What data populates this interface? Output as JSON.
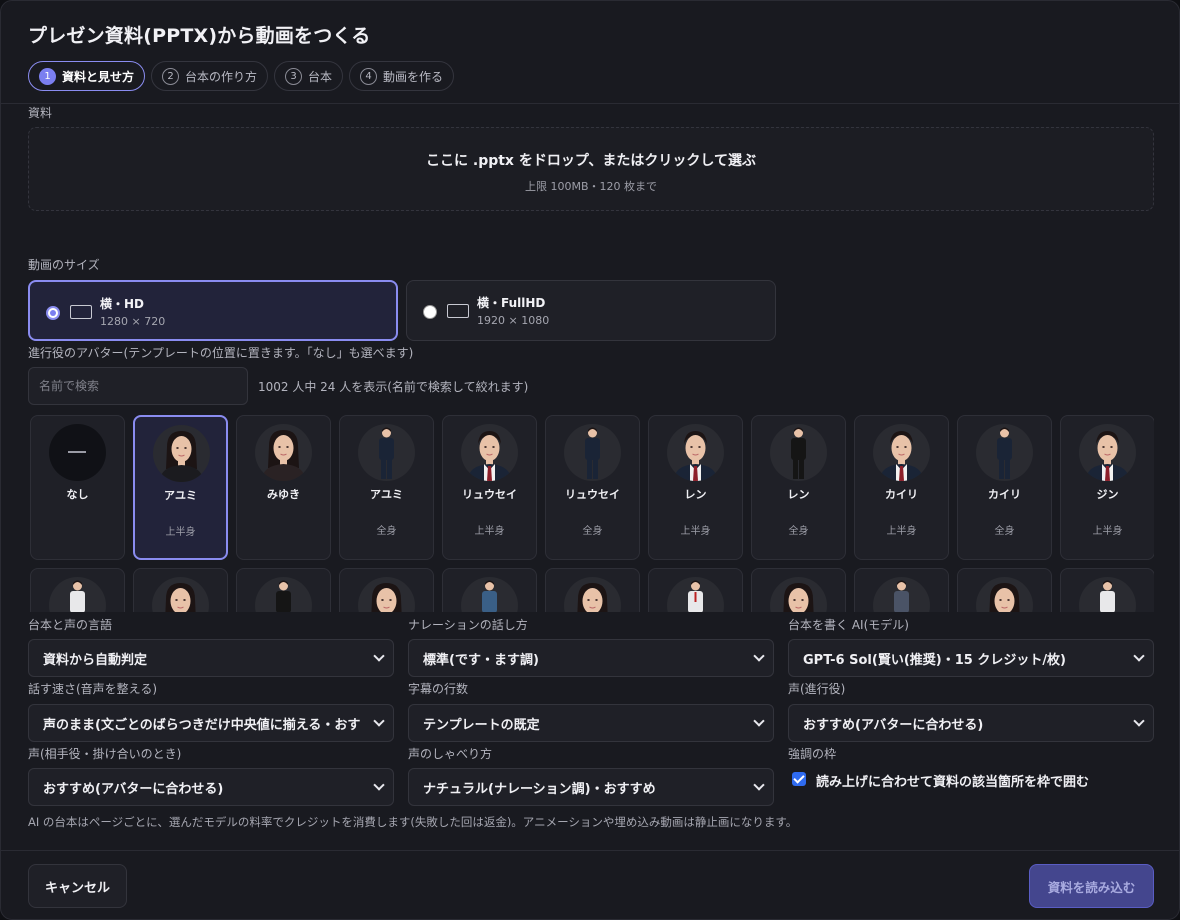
{
  "dialog": {
    "title": "プレゼン資料(PPTX)から動画をつくる",
    "steps": [
      {
        "num": "1",
        "label": "資料と見せ方"
      },
      {
        "num": "2",
        "label": "台本の作り方"
      },
      {
        "num": "3",
        "label": "台本"
      },
      {
        "num": "4",
        "label": "動画を作る"
      }
    ],
    "active_step": 1
  },
  "material": {
    "label": "資料",
    "dropzone_main": "ここに .pptx をドロップ、またはクリックして選ぶ",
    "dropzone_sub": "上限 100MB・120 枚まで"
  },
  "video_size": {
    "label": "動画のサイズ",
    "options": [
      {
        "name": "横・HD",
        "dims": "1280 × 720",
        "selected": true
      },
      {
        "name": "横・FullHD",
        "dims": "1920 × 1080",
        "selected": false
      }
    ]
  },
  "avatar": {
    "label": "進行役のアバター(テンプレートの位置に置きます。「なし」も選べます)",
    "search_placeholder": "名前で検索",
    "count_text": "1002 人中 24 人を表示(名前で検索して絞れます)",
    "row1": [
      {
        "name": "なし",
        "type": "",
        "kind": "none"
      },
      {
        "name": "アユミ",
        "type": "上半身",
        "kind": "f-upper",
        "selected": true
      },
      {
        "name": "みゆき",
        "type": "",
        "kind": "f-upper2"
      },
      {
        "name": "アユミ",
        "type": "全身",
        "kind": "f-full"
      },
      {
        "name": "リュウセイ",
        "type": "上半身",
        "kind": "m-upper"
      },
      {
        "name": "リュウセイ",
        "type": "全身",
        "kind": "m-full-navy"
      },
      {
        "name": "レン",
        "type": "上半身",
        "kind": "m-upper-dark"
      },
      {
        "name": "レン",
        "type": "全身",
        "kind": "m-full-dark"
      },
      {
        "name": "カイリ",
        "type": "上半身",
        "kind": "m-upper2"
      },
      {
        "name": "カイリ",
        "type": "全身",
        "kind": "m-full-navy"
      },
      {
        "name": "ジン",
        "type": "上半身",
        "kind": "m-upper3"
      }
    ],
    "row2": [
      {
        "kind": "m-white"
      },
      {
        "kind": "f-upper"
      },
      {
        "kind": "f-black"
      },
      {
        "kind": "f-upper2"
      },
      {
        "kind": "f-blue"
      },
      {
        "kind": "f-upper3"
      },
      {
        "kind": "m-white-tie"
      },
      {
        "kind": "f-upper"
      },
      {
        "kind": "m-gray"
      },
      {
        "kind": "f-upper2"
      },
      {
        "kind": "m-white"
      }
    ]
  },
  "settings": {
    "language": {
      "label": "台本と声の言語",
      "value": "資料から自動判定"
    },
    "narration": {
      "label": "ナレーションの話し方",
      "value": "標準(です・ます調)"
    },
    "ai_model": {
      "label": "台本を書く AI(モデル)",
      "value": "GPT-6 Sol(賢い(推奨)・15 クレジット/枚)"
    },
    "speed": {
      "label": "話す速さ(音声を整える)",
      "value": "声のまま(文ごとのばらつきだけ中央値に揃える・おすすめ)"
    },
    "caption_lines": {
      "label": "字幕の行数",
      "value": "テンプレートの既定"
    },
    "voice_host": {
      "label": "声(進行役)",
      "value": "おすすめ(アバターに合わせる)"
    },
    "voice_partner": {
      "label": "声(相手役・掛け合いのとき)",
      "value": "おすすめ(アバターに合わせる)"
    },
    "voice_style": {
      "label": "声のしゃべり方",
      "value": "ナチュラル(ナレーション調)・おすすめ"
    },
    "highlight": {
      "label": "強調の枠",
      "checkbox_label": "読み上げに合わせて資料の該当箇所を枠で囲む",
      "checked": true
    }
  },
  "note": "AI の台本はページごとに、選んだモデルの料率でクレジットを消費します(失敗した回は返金)。アニメーションや埋め込み動画は静止画になります。",
  "footer": {
    "cancel": "キャンセル",
    "load": "資料を読み込む"
  },
  "colors": {
    "accent": "#7b7ff0",
    "background": "#191a20",
    "check": "#2f6bf0"
  }
}
